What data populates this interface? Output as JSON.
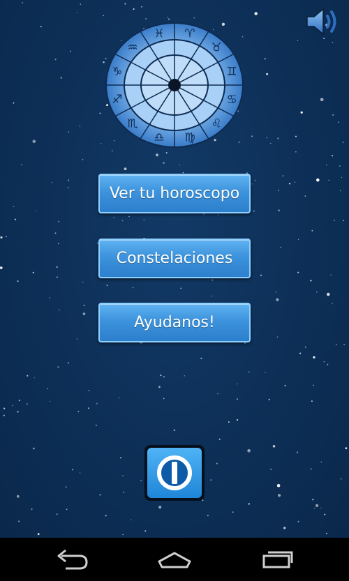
{
  "menu": {
    "horoscope_label": "Ver tu horoscopo",
    "constellations_label": "Constelaciones",
    "help_label": "Ayudanos!"
  },
  "icons": {
    "sound": "speaker-icon",
    "zodiac": "zodiac-wheel-icon",
    "power": "power-icon",
    "back": "back-icon",
    "home": "home-icon",
    "recent": "recent-apps-icon"
  },
  "colors": {
    "background": "#0d2f57",
    "button": "#3d93dc",
    "button_border": "#8fd0ff",
    "navbar": "#000000"
  }
}
